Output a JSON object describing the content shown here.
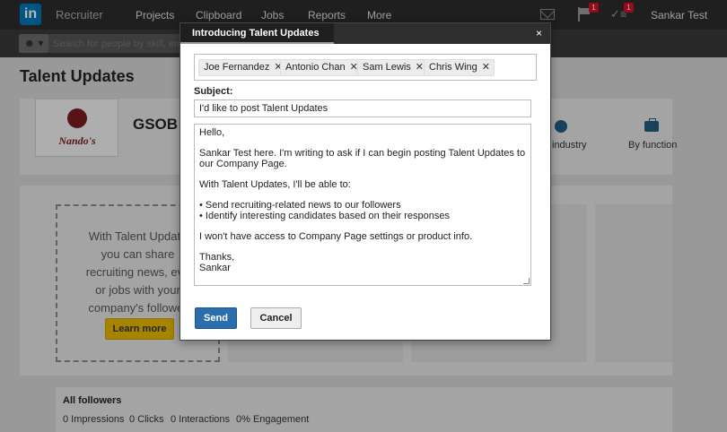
{
  "nav": {
    "logo": "in",
    "product": "Recruiter",
    "items": [
      "Projects",
      "Clipboard",
      "Jobs",
      "Reports",
      "More"
    ],
    "notification_badge": "1",
    "tasks_badge": "1",
    "user": "Sankar Test"
  },
  "search": {
    "placeholder": "Search for people by skill, emp",
    "person_glyph": "☻ ▾"
  },
  "page": {
    "title": "Talent Updates",
    "company_logo_text": "Nando's",
    "company_name": "GSOB",
    "filters": [
      "industry",
      "By function"
    ]
  },
  "promo": {
    "text": "With Talent Update\nyou can share\nrecruiting news, eve\nor jobs with your\ncompany's follower",
    "button": "Learn more"
  },
  "followers": {
    "title": "All followers",
    "stats": [
      "0 Impressions",
      "0 Clicks",
      "0 Interactions",
      "0% Engagement"
    ]
  },
  "modal": {
    "title": "Introducing Talent Updates",
    "close": "×",
    "recipients": [
      "Joe Fernandez",
      "Antonio Chan",
      "Sam Lewis",
      "Chris Wing"
    ],
    "remove_glyph": "✕",
    "subject_label": "Subject:",
    "subject_value": "I'd like to post Talent Updates",
    "message": "Hello,\n\nSankar Test here. I'm writing to ask if I can begin posting Talent Updates to our Company Page.\n\nWith Talent Updates, I'll be able to:\n\n• Send recruiting-related news to our followers\n• Identify interesting candidates based on their responses\n\nI won't have access to Company Page settings or product info.\n\nThanks,\nSankar",
    "send": "Send",
    "cancel": "Cancel"
  },
  "colors": {
    "nav_bg": "#2b2b2b",
    "brand_blue": "#0077b5",
    "send_blue": "#2c6dad",
    "learn_more_yellow": "#e6b800",
    "badge_red": "#d11124"
  }
}
